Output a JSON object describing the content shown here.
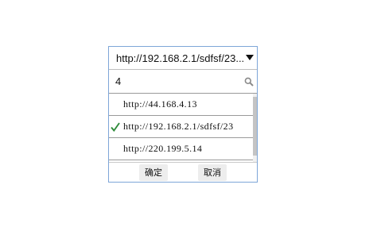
{
  "select": {
    "value": "http://192.168.2.1/sdfsf/23..."
  },
  "search": {
    "value": "4",
    "icon": "search-icon"
  },
  "list": {
    "items": [
      {
        "label": "http://44.168.4.13",
        "selected": false
      },
      {
        "label": "http://192.168.2.1/sdfsf/23",
        "selected": true
      },
      {
        "label": "http://220.199.5.14",
        "selected": false
      }
    ]
  },
  "buttons": {
    "confirm_label": "确定",
    "cancel_label": "取消"
  },
  "colors": {
    "border": "#7ea6d8",
    "check": "#2e8b3a",
    "button_bg": "#ededed"
  }
}
